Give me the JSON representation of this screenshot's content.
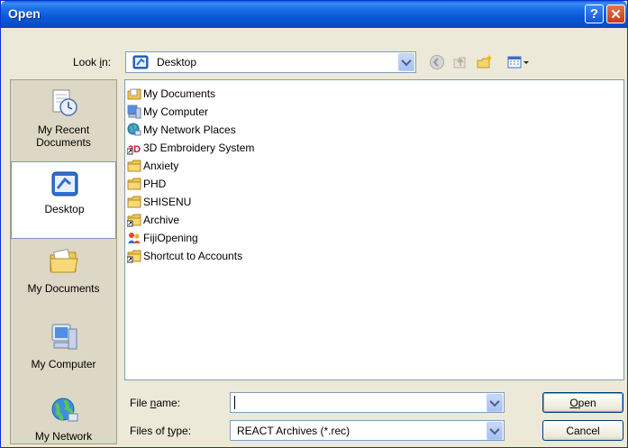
{
  "window": {
    "title": "Open",
    "help_glyph": "?",
    "close_glyph": "✕"
  },
  "lookin": {
    "label_pre": "Look ",
    "label_mnemonic": "i",
    "label_post": "n:",
    "value": "Desktop",
    "icon": "desktop-icon"
  },
  "toolbar": {
    "icons": [
      "back-icon",
      "up-folder-icon",
      "new-folder-icon",
      "views-menu-icon"
    ]
  },
  "places": [
    {
      "label": "My Recent\nDocuments",
      "icon": "recent-documents-icon",
      "selected": false
    },
    {
      "label": "Desktop",
      "icon": "desktop-icon",
      "selected": true
    },
    {
      "label": "My Documents",
      "icon": "my-documents-icon",
      "selected": false
    },
    {
      "label": "My Computer",
      "icon": "my-computer-icon",
      "selected": false
    },
    {
      "label": "My Network",
      "icon": "network-icon",
      "selected": false
    }
  ],
  "files": [
    {
      "name": "My Documents",
      "icon": "my-documents-icon"
    },
    {
      "name": "My Computer",
      "icon": "my-computer-icon"
    },
    {
      "name": "My Network Places",
      "icon": "network-icon"
    },
    {
      "name": "3D Embroidery System",
      "icon": "3d-app-shortcut-icon"
    },
    {
      "name": "Anxiety",
      "icon": "folder-icon"
    },
    {
      "name": "PHD",
      "icon": "folder-icon"
    },
    {
      "name": "SHISENU",
      "icon": "folder-icon"
    },
    {
      "name": "Archive",
      "icon": "folder-shortcut-icon"
    },
    {
      "name": "FijiOpening",
      "icon": "people-icon"
    },
    {
      "name": "Shortcut to Accounts",
      "icon": "folder-shortcut-icon"
    }
  ],
  "filename": {
    "label_pre": "File ",
    "label_mnemonic": "n",
    "label_post": "ame:",
    "value": ""
  },
  "filetype": {
    "label_pre": "Files of ",
    "label_mnemonic": "t",
    "label_post": "ype:",
    "value": "REACT Archives (*.rec)"
  },
  "buttons": {
    "open_mnemonic": "O",
    "open_rest": "pen",
    "cancel": "Cancel"
  }
}
